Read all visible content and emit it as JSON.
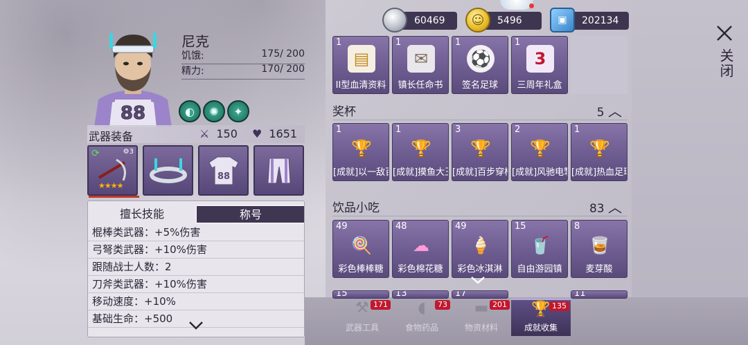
{
  "currencies": [
    {
      "icon": "can-icon",
      "value": "60469"
    },
    {
      "icon": "coin-icon",
      "value": "5496"
    },
    {
      "icon": "ticket-icon",
      "value": "202134"
    }
  ],
  "character": {
    "name": "尼克",
    "hunger_label": "饥饿:",
    "hunger_value": "175/ 200",
    "energy_label": "精力:",
    "energy_value": "170/ 200",
    "jersey_number": "88",
    "status_icons": [
      "stomach-icon",
      "virus-icon",
      "body-icon"
    ]
  },
  "weapon": {
    "title": "武器装备",
    "attack": "150",
    "health": "1651",
    "slots": [
      {
        "name": "weapon-slot",
        "level": "3",
        "stars": "★★★★"
      },
      {
        "name": "headgear-slot"
      },
      {
        "name": "jersey-slot",
        "number": "88"
      },
      {
        "name": "pants-slot"
      }
    ]
  },
  "skills": {
    "tabs": [
      "擅长技能",
      "称号"
    ],
    "active_tab": 1,
    "rows": [
      "棍棒类武器：+5%伤害",
      "弓弩类武器：+10%伤害",
      "跟随战士人数：2",
      "刀斧类武器：+10%伤害",
      "移动速度：+10%",
      "基础生命：+500"
    ]
  },
  "inventory": {
    "top_row": [
      {
        "count": "1",
        "label": "II型血清资料"
      },
      {
        "count": "1",
        "label": "镇长任命书"
      },
      {
        "count": "1",
        "label": "签名足球"
      },
      {
        "count": "1",
        "label": "三周年礼盒",
        "badge": "3"
      }
    ],
    "trophies": {
      "title": "奖杯",
      "count": "5",
      "items": [
        {
          "count": "1",
          "label": "[成就]以一敌百"
        },
        {
          "count": "1",
          "label": "[成就]摸鱼大王"
        },
        {
          "count": "3",
          "label": "[成就]百步穿杨"
        },
        {
          "count": "2",
          "label": "[成就]风驰电掣"
        },
        {
          "count": "1",
          "label": "[成就]热血足球"
        }
      ]
    },
    "snacks": {
      "title": "饮品小吃",
      "count": "83",
      "items": [
        {
          "count": "49",
          "label": "彩色棒棒糖"
        },
        {
          "count": "48",
          "label": "彩色棉花糖"
        },
        {
          "count": "49",
          "label": "彩色冰淇淋"
        },
        {
          "count": "15",
          "label": "自由游园镇"
        },
        {
          "count": "8",
          "label": "麦芽酸"
        }
      ],
      "partial_counts": [
        "15",
        "13",
        "17",
        "11"
      ]
    }
  },
  "bottom_tabs": [
    {
      "label": "武器工具",
      "badge": "171"
    },
    {
      "label": "食物药品",
      "badge": "73"
    },
    {
      "label": "物资材料",
      "badge": "201"
    },
    {
      "label": "成就收集",
      "badge": "135"
    }
  ],
  "close_label": "关闭"
}
